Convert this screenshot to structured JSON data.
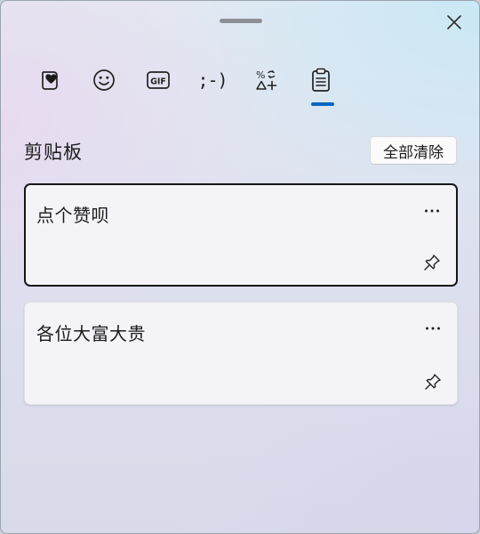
{
  "window": {
    "tabs": [
      {
        "name": "favorites",
        "icon": "heart-sticky-note-icon"
      },
      {
        "name": "emoji",
        "icon": "smiley-icon"
      },
      {
        "name": "gif",
        "icon": "gif-icon",
        "label": "GIF"
      },
      {
        "name": "kaomoji",
        "icon": "kaomoji-icon",
        "label": ";-)"
      },
      {
        "name": "symbols",
        "icon": "symbols-icon"
      },
      {
        "name": "clipboard",
        "icon": "clipboard-icon",
        "selected": true
      }
    ],
    "accent_color": "#0067c0"
  },
  "clipboard": {
    "title": "剪贴板",
    "clear_all_label": "全部清除",
    "items": [
      {
        "text": "点个赞呗",
        "selected": true
      },
      {
        "text": "各位大富大贵",
        "selected": false
      }
    ]
  }
}
